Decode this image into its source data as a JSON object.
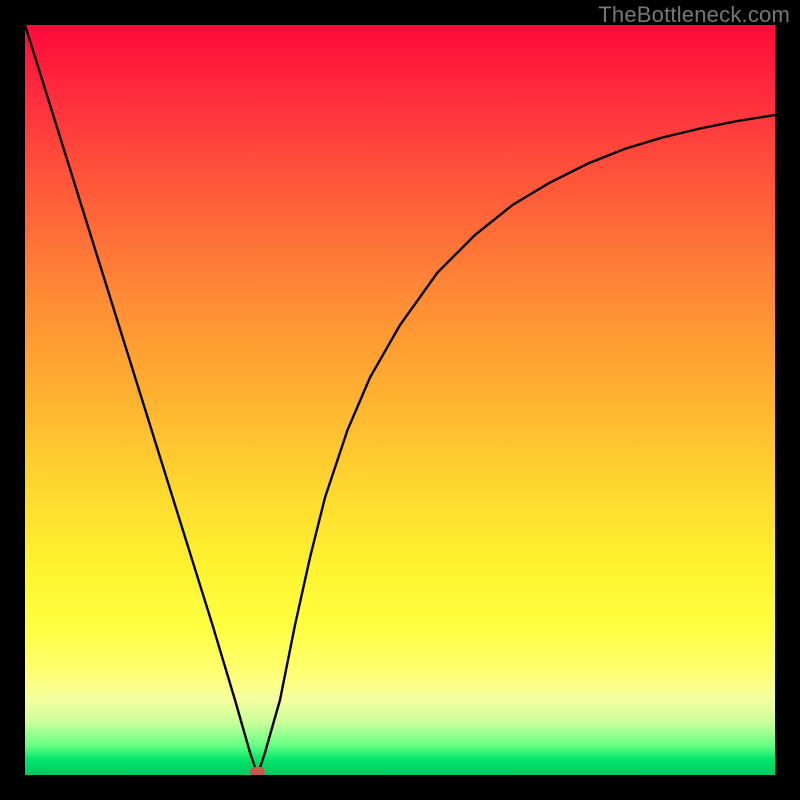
{
  "watermark": "TheBottleneck.com",
  "chart_data": {
    "type": "line",
    "title": "",
    "xlabel": "",
    "ylabel": "",
    "xlim": [
      0,
      100
    ],
    "ylim": [
      0,
      100
    ],
    "gradient_colors": {
      "top": "#ff0a3a",
      "bottom": "#00c95e"
    },
    "minimum_marker": {
      "x": 31,
      "y": 0,
      "color": "#c65a4a"
    },
    "series": [
      {
        "name": "bottleneck-curve",
        "x": [
          0,
          5,
          10,
          15,
          20,
          25,
          28,
          30,
          31,
          32,
          34,
          36,
          38,
          40,
          43,
          46,
          50,
          55,
          60,
          65,
          70,
          75,
          80,
          85,
          90,
          95,
          100
        ],
        "y": [
          100,
          84,
          68,
          52,
          36,
          20,
          10,
          3,
          0,
          3,
          10,
          20,
          29,
          37,
          46,
          53,
          60,
          67,
          72,
          76,
          79,
          81.5,
          83.5,
          85,
          86.2,
          87.2,
          88
        ]
      }
    ]
  }
}
